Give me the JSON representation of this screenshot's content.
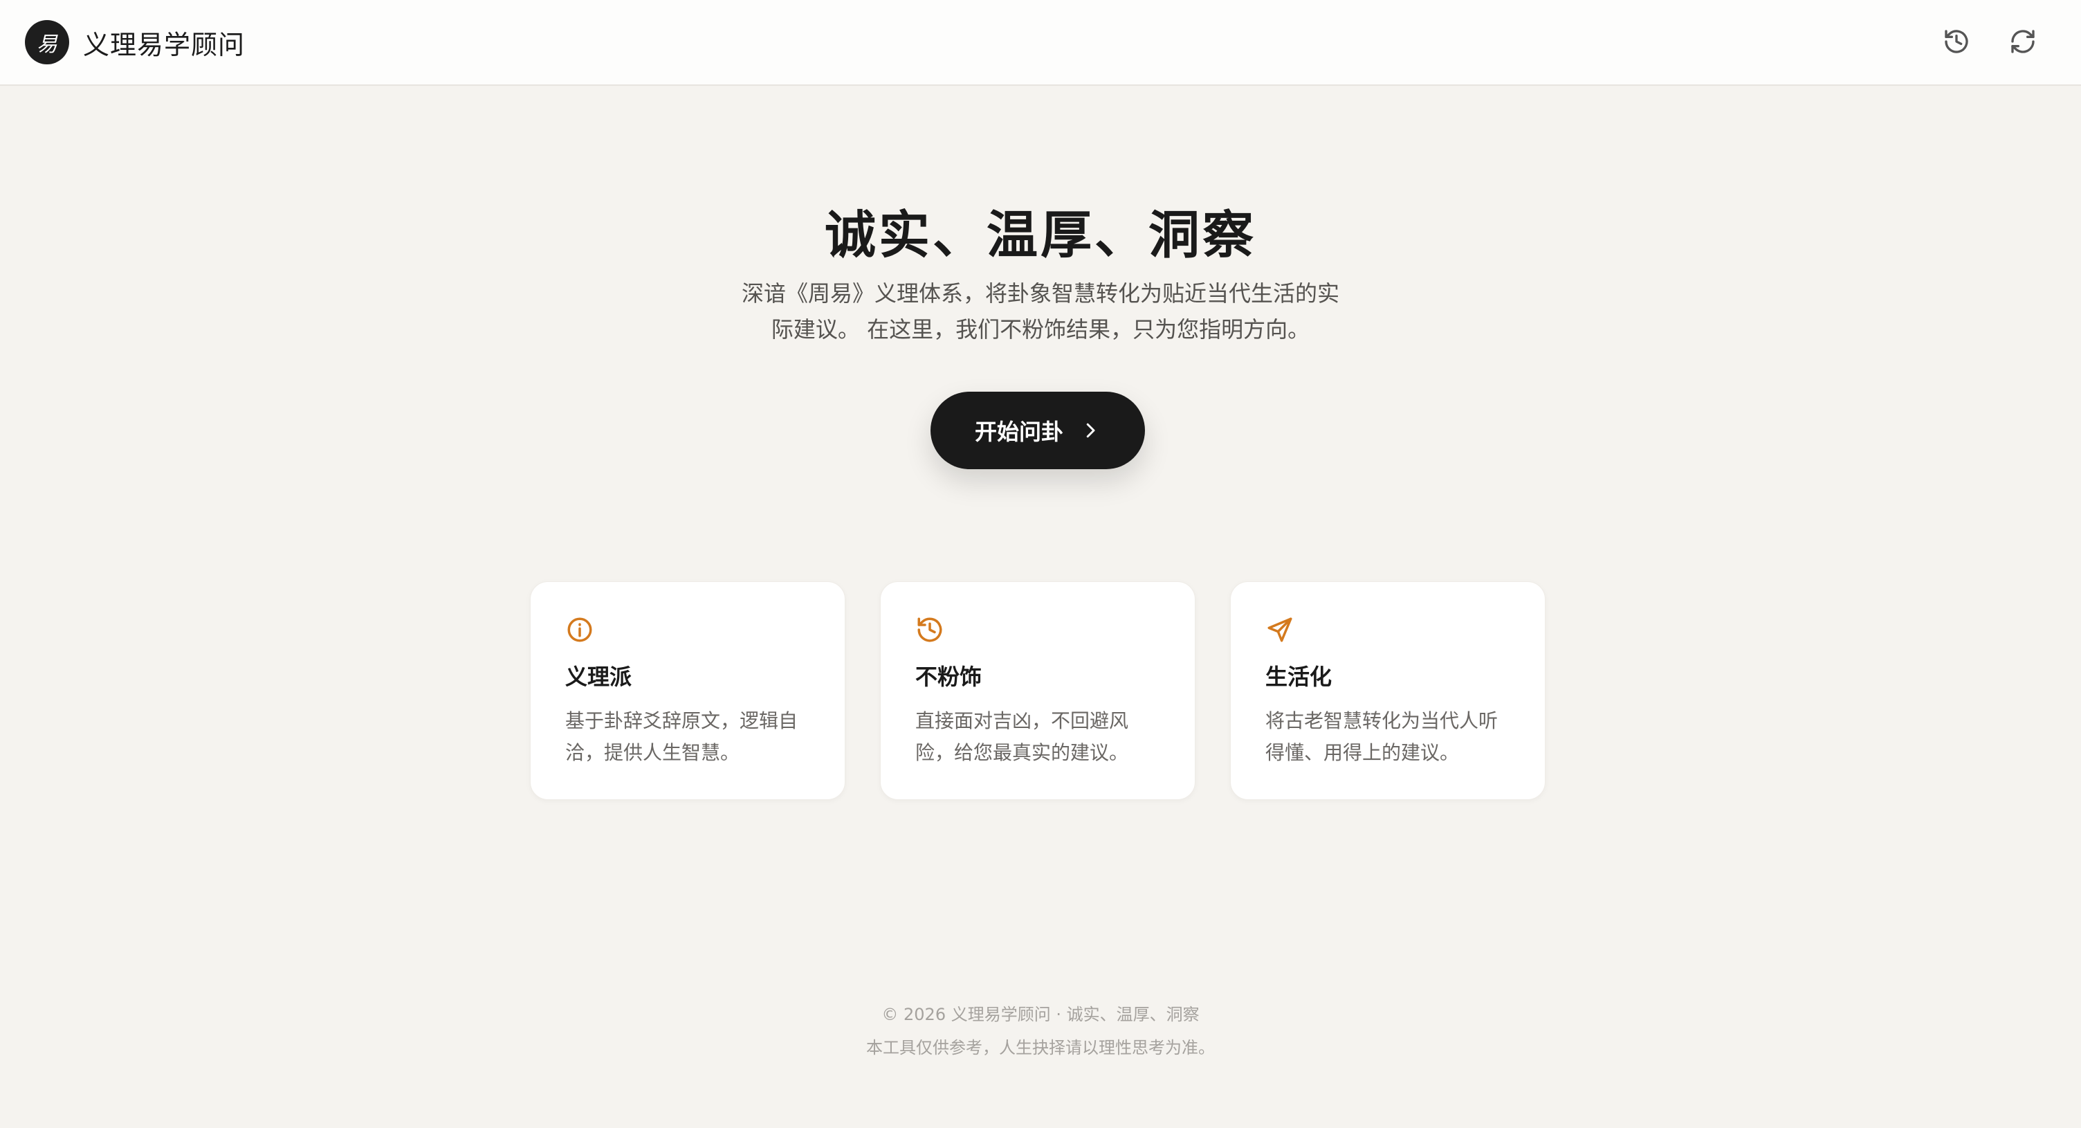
{
  "header": {
    "logo_glyph": "易",
    "app_name": "义理易学顾问",
    "history_icon": "history-icon",
    "refresh_icon": "refresh-icon"
  },
  "hero": {
    "title": "诚实、温厚、洞察",
    "description_line1": "深谙《周易》义理体系，将卦象智慧转化为贴近当代生活的实",
    "description_line2": "际建议。 在这里，我们不粉饰结果，只为您指明方向。",
    "cta_label": "开始问卦",
    "cta_icon": "chevron-right-icon"
  },
  "features": [
    {
      "icon": "info-circle-icon",
      "title": "义理派",
      "text_line1": "基于卦辞爻辞原文，逻辑自",
      "text_line2": "洽，提供人生智慧。"
    },
    {
      "icon": "history-icon",
      "title": "不粉饰",
      "text_line1": "直接面对吉凶，不回避风",
      "text_line2": "险，给您最真实的建议。"
    },
    {
      "icon": "send-icon",
      "title": "生活化",
      "text_line1": "将古老智慧转化为当代人听",
      "text_line2": "得懂、用得上的建议。"
    }
  ],
  "footer": {
    "copyright": "© 2026 义理易学顾问 · 诚实、温厚、洞察",
    "disclaimer": "本工具仅供参考，人生抉择请以理性思考为准。"
  },
  "colors": {
    "accent": "#d47a1e",
    "background": "#f5f3ef",
    "dark": "#1a1a1a"
  }
}
